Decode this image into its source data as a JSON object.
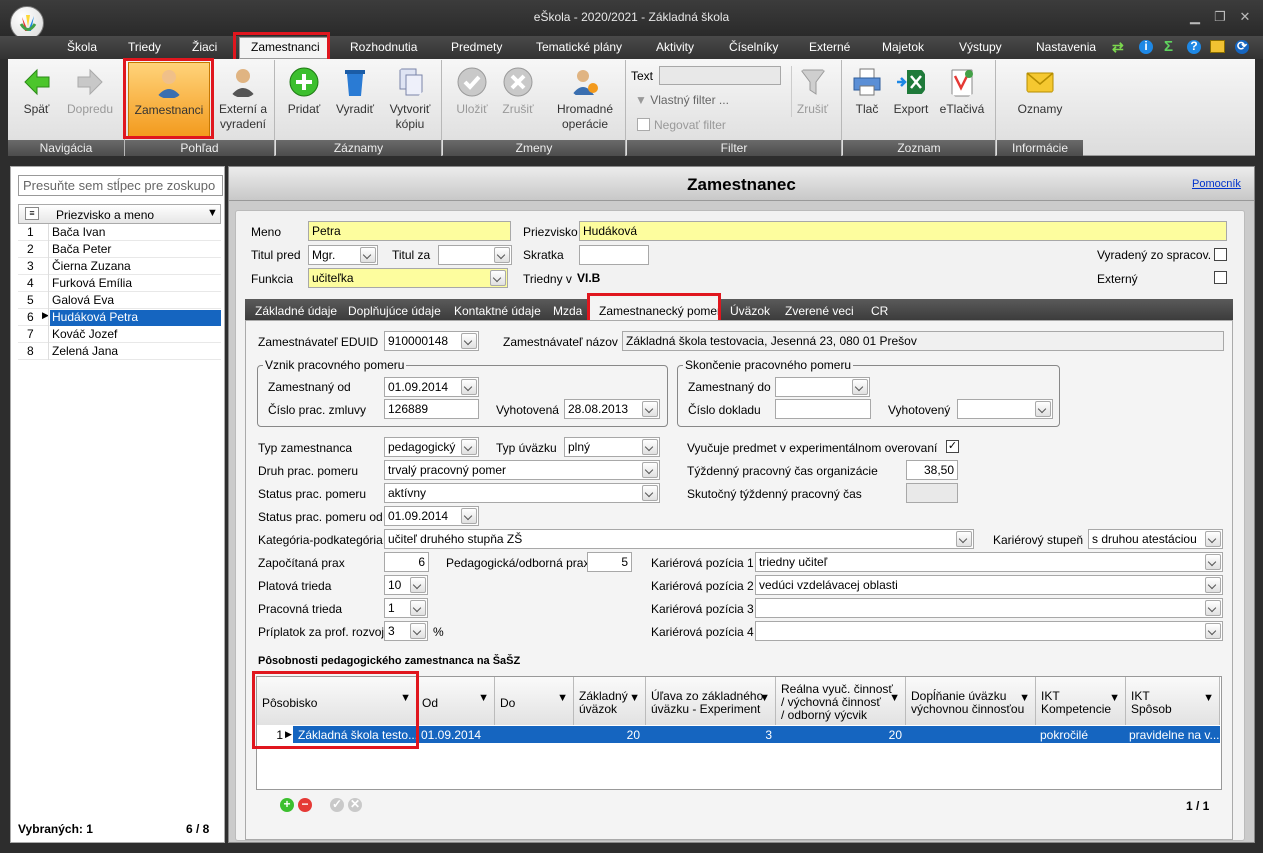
{
  "window": {
    "title": "eŠkola - 2020/2021 - Základná škola",
    "minimize": "▁",
    "restore": "❐",
    "close": "✕"
  },
  "menu": [
    "Škola",
    "Triedy",
    "Žiaci",
    "Zamestnanci",
    "Rozhodnutia",
    "Predmety",
    "Tematické plány",
    "Aktivity",
    "Číselníky",
    "Externé",
    "Majetok",
    "Výstupy",
    "Nastavenia"
  ],
  "ribbon": {
    "navigation": {
      "label": "Navigácia",
      "back": "Späť",
      "forward": "Dopredu"
    },
    "view": {
      "label": "Pohľad",
      "employees": "Zamestnanci",
      "external_line1": "Externí a",
      "external_line2": "vyradení"
    },
    "records": {
      "label": "Záznamy",
      "add": "Pridať",
      "remove": "Vyradiť",
      "copy_line1": "Vytvoriť",
      "copy_line2": "kópiu"
    },
    "changes": {
      "label": "Zmeny",
      "save": "Uložiť",
      "cancel": "Zrušiť",
      "bulk_line1": "Hromadné",
      "bulk_line2": "operácie"
    },
    "filter": {
      "label": "Filter",
      "text_label": "Text",
      "custom": "Vlastný filter ...",
      "negate": "Negovať filter",
      "cancel": "Zrušiť"
    },
    "list": {
      "label": "Zoznam",
      "print": "Tlač",
      "export": "Export",
      "eprint": "eTlačivá"
    },
    "info": {
      "label": "Informácie",
      "notices": "Oznamy"
    }
  },
  "left": {
    "search_placeholder": "Presuňte sem stĺpec pre zoskupo",
    "column": "Priezvisko a meno",
    "rows": [
      {
        "n": "1",
        "name": "Bača Ivan"
      },
      {
        "n": "2",
        "name": "Bača Peter"
      },
      {
        "n": "3",
        "name": "Čierna Zuzana"
      },
      {
        "n": "4",
        "name": "Furková Emília"
      },
      {
        "n": "5",
        "name": "Galová Eva"
      },
      {
        "n": "6",
        "name": "Hudáková Petra"
      },
      {
        "n": "7",
        "name": "Kováč Jozef"
      },
      {
        "n": "8",
        "name": "Zelená Jana"
      }
    ],
    "selected_label": "Vybraných: 1",
    "count": "6 / 8"
  },
  "form": {
    "title": "Zamestnanec",
    "help": "Pomocník",
    "name_label": "Meno",
    "name": "Petra",
    "surname_label": "Priezvisko",
    "surname": "Hudáková",
    "title_before_label": "Titul pred",
    "title_before": "Mgr.",
    "title_after_label": "Titul za",
    "title_after": "",
    "abbr_label": "Skratka",
    "abbr": "",
    "retired_label": "Vyradený zo spracov.",
    "function_label": "Funkcia",
    "function": "učiteľka",
    "class_teacher_label": "Triedny v",
    "class_teacher": "VI.B",
    "external_label": "Externý"
  },
  "tabs": [
    "Základné údaje",
    "Doplňujúce údaje",
    "Kontaktné údaje",
    "Mzda",
    "Zamestnanecký pomer",
    "Úväzok",
    "Zverené veci",
    "CR"
  ],
  "emp": {
    "employer_id_label": "Zamestnávateľ EDUID",
    "employer_id": "910000148",
    "employer_name_label": "Zamestnávateľ názov",
    "employer_name": "Základná škola testovacia, Jesenná 23, 080 01 Prešov",
    "start_legend": "Vznik pracovného pomeru",
    "employed_from_label": "Zamestnaný od",
    "employed_from": "01.09.2014",
    "contract_no_label": "Číslo prac. zmluvy",
    "contract_no": "126889",
    "issued_label": "Vyhotovená",
    "issued": "28.08.2013",
    "end_legend": "Skončenie pracovného pomeru",
    "employed_to_label": "Zamestnaný do",
    "employed_to": "",
    "doc_no_label": "Číslo dokladu",
    "doc_no": "",
    "issued_end_label": "Vyhotovený",
    "issued_end": "",
    "type_label": "Typ zamestnanca",
    "type": "pedagogický",
    "workload_type_label": "Typ úväzku",
    "workload_type": "plný",
    "experimental_label": "Vyučuje predmet v experimentálnom overovaní",
    "kind_label": "Druh prac. pomeru",
    "kind": "trvalý pracovný pomer",
    "weekly_org_label": "Týždenný pracovný čas organizácie",
    "weekly_org": "38,50",
    "status_label": "Status prac. pomeru",
    "status": "aktívny",
    "weekly_real_label": "Skutočný týždenný pracovný čas",
    "status_from_label": "Status prac. pomeru od",
    "status_from": "01.09.2014",
    "category_label": "Kategória-podkategória",
    "category": "učiteľ druhého stupňa ZŠ",
    "career_level_label": "Kariérový stupeň",
    "career_level": "s druhou atestáciou",
    "counted_practice_label": "Započítaná prax",
    "counted_practice": "6",
    "ped_practice_label": "Pedagogická/odborná prax",
    "ped_practice": "5",
    "pos1_label": "Kariérová pozícia 1",
    "pos1": "triedny učiteľ",
    "pos2_label": "Kariérová pozícia 2",
    "pos2": "vedúci vzdelávacej oblasti",
    "pos3_label": "Kariérová pozícia 3",
    "pos3": "",
    "pos4_label": "Kariérová pozícia 4",
    "pos4": "",
    "salary_class_label": "Platová trieda",
    "salary_class": "10",
    "work_class_label": "Pracovná trieda",
    "work_class": "1",
    "bonus_label": "Príplatok za prof. rozvoj",
    "bonus": "3",
    "percent": "%",
    "grid_title": "Pôsobnosti pedagogického zamestnanca na ŠaŠZ",
    "grid_headers": {
      "place": "Pôsobisko",
      "from": "Od",
      "to": "Do",
      "base1": "Základný",
      "base2": "úväzok",
      "relief1": "Úľava zo základného",
      "relief2": "úväzku - Experiment",
      "real1": "Reálna vyuč. činnosť",
      "real2": "/ výchovná činnosť",
      "real3": "/ odborný výcvik",
      "fill1": "Dopĺňanie úväzku",
      "fill2": "výchovnou činnosťou",
      "ikt1": "IKT",
      "ikt2": "Kompetencie",
      "iktw1": "IKT",
      "iktw2": "Spôsob"
    },
    "grid_row": {
      "n": "1",
      "place": "Základná škola testo...",
      "from": "01.09.2014",
      "to": "",
      "base": "20",
      "relief": "3",
      "real": "20",
      "fill": "",
      "ikt": "pokročilé",
      "iktw": "pravidelne na v..."
    },
    "pager": "1 / 1"
  }
}
